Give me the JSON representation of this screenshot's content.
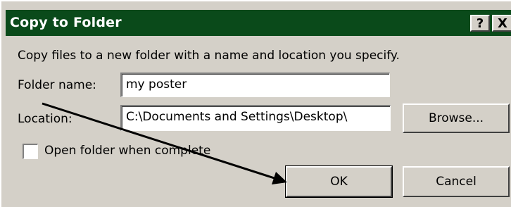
{
  "dialog": {
    "title": "Copy to Folder",
    "help_label": "?",
    "close_label": "X"
  },
  "intro_text": "Copy files to a new folder with a name and location you specify.",
  "folder_name": {
    "label": "Folder name:",
    "value": "my poster"
  },
  "location": {
    "label": "Location:",
    "value": "C:\\Documents and Settings\\Desktop\\"
  },
  "buttons": {
    "browse": "Browse...",
    "ok": "OK",
    "cancel": "Cancel"
  },
  "open_folder": {
    "label": "Open folder when complete",
    "checked": false
  },
  "colors": {
    "titlebar": "#0a4a1a",
    "dialog_bg": "#d4d0c8",
    "annotation_arrow": "#000000"
  }
}
